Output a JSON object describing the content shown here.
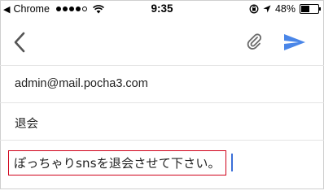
{
  "status_bar": {
    "back_app": "Chrome",
    "back_arrow": "◀",
    "signal_dots": [
      true,
      true,
      true,
      true,
      false
    ],
    "time": "9:35",
    "battery_text": "48%",
    "battery_level": 0.48
  },
  "toolbar": {
    "accent_color": "#4a86e8"
  },
  "compose": {
    "to": "admin@mail.pocha3.com",
    "subject": "退会",
    "body": "ぽっちゃりsnsを退会させて下さい。"
  },
  "colors": {
    "highlight_border": "#d0021b",
    "caret": "#3b6fd8"
  }
}
